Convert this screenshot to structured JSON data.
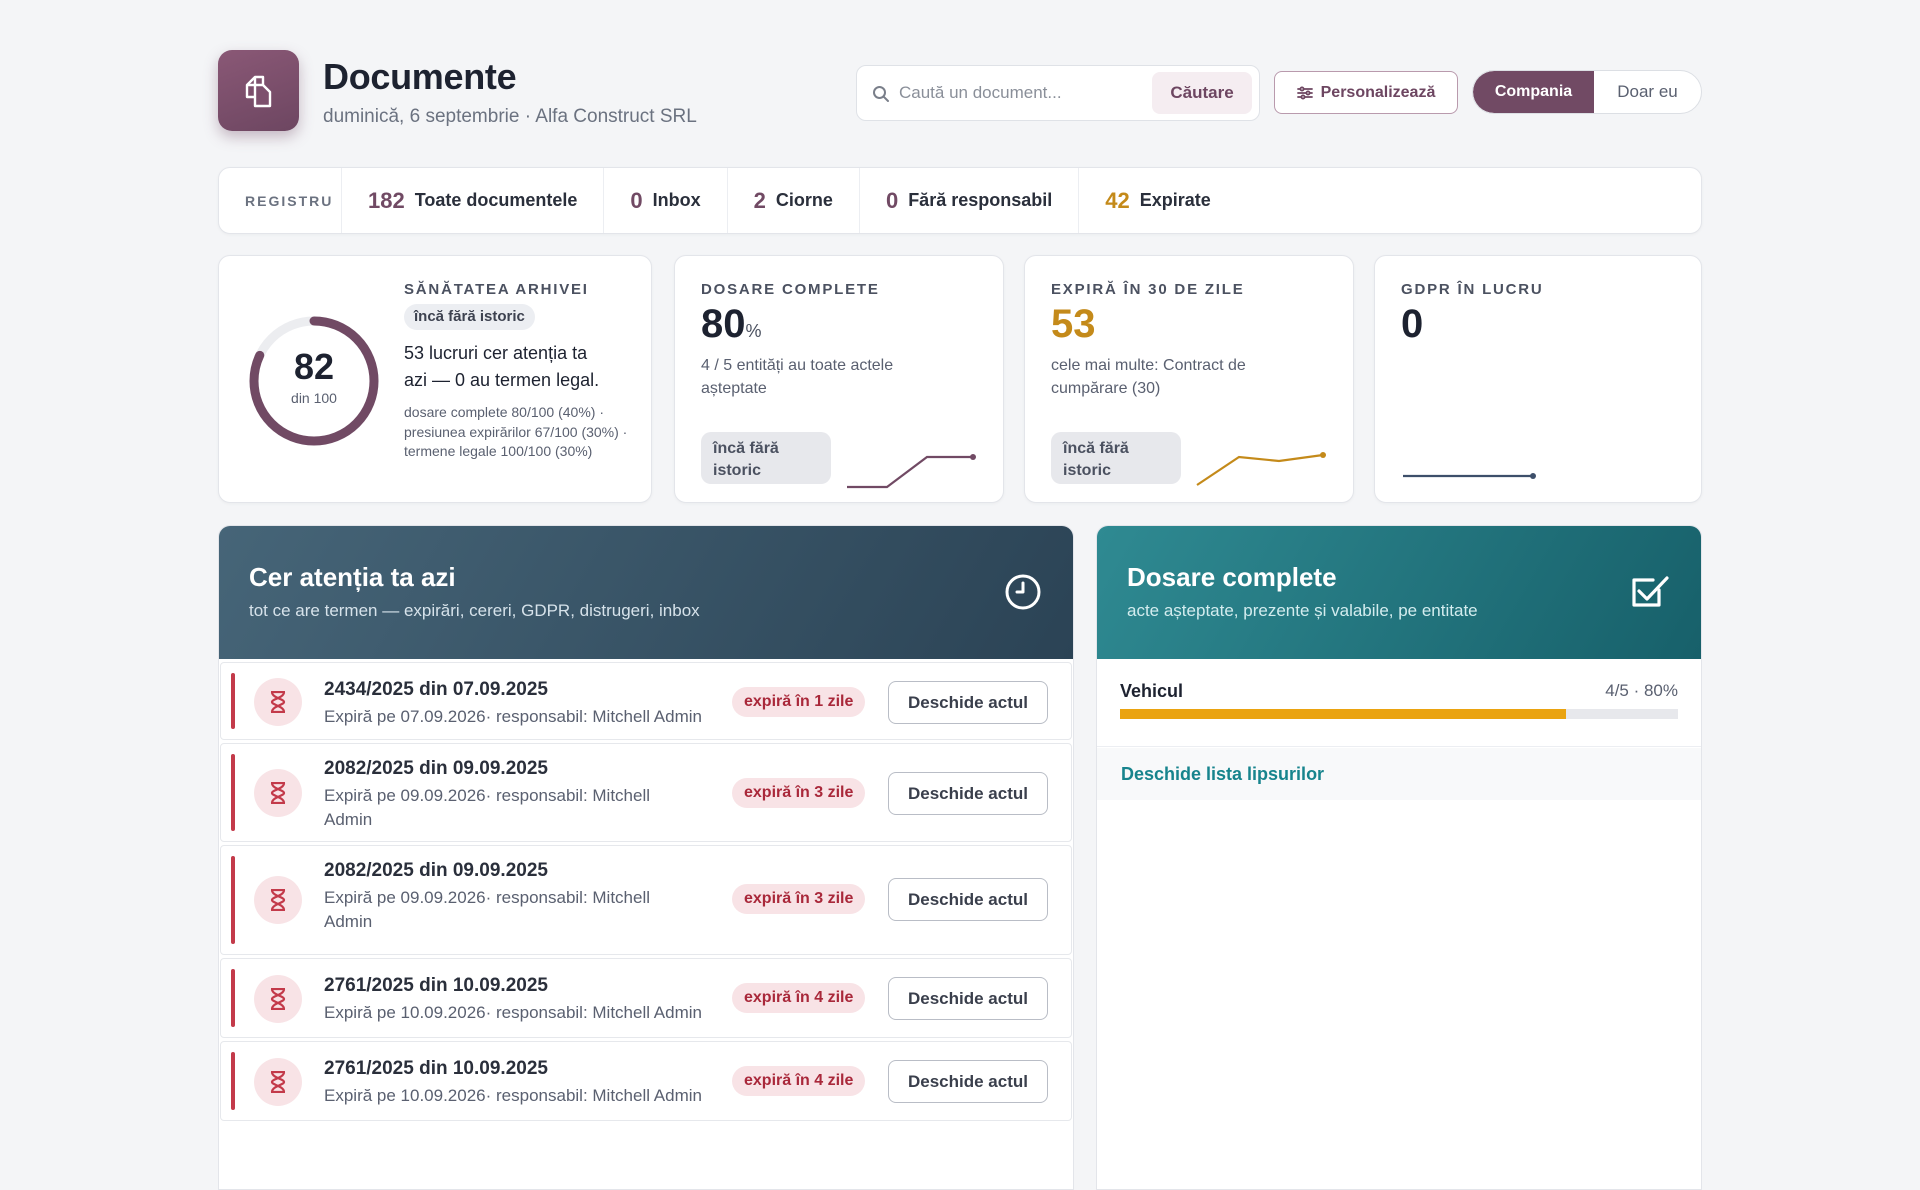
{
  "header": {
    "title": "Documente",
    "subtitle": "duminică, 6 septembrie · Alfa Construct SRL",
    "search_placeholder": "Caută un document...",
    "search_button": "Căutare",
    "customize_button": "Personalizează",
    "scope_company": "Compania",
    "scope_me": "Doar eu"
  },
  "registry": {
    "label": "REGISTRU",
    "items": [
      {
        "count": "182",
        "label": "Toate documentele"
      },
      {
        "count": "0",
        "label": "Inbox"
      },
      {
        "count": "2",
        "label": "Ciorne"
      },
      {
        "count": "0",
        "label": "Fără responsabil"
      },
      {
        "count": "42",
        "label": "Expirate"
      }
    ]
  },
  "health": {
    "score": "82",
    "score_of": "din 100",
    "score_fraction": 0.82,
    "title": "SĂNĂTATEA ARHIVEI",
    "badge": "încă fără istoric",
    "summary": "53 lucruri cer atenția ta azi — 0 au termen legal.",
    "detail": "dosare complete 80/100 (40%) · presiunea expirărilor 67/100 (30%) · termene legale 100/100 (30%)"
  },
  "kpis": {
    "complete": {
      "title": "DOSARE COMPLETE",
      "value": "80",
      "unit": "%",
      "desc": "4 / 5 entități au toate actele așteptate",
      "pill": "încă fără istoric"
    },
    "expiring": {
      "title": "EXPIRĂ ÎN 30 DE ZILE",
      "value": "53",
      "desc": "cele mai multe: Contract de cumpărare (30)",
      "pill": "încă fără istoric"
    },
    "gdpr": {
      "title": "GDPR ÎN LUCRU",
      "value": "0"
    }
  },
  "attention": {
    "title": "Cer atenția ta azi",
    "subtitle": "tot ce are termen — expirări, cereri, GDPR, distrugeri, inbox",
    "rows": [
      {
        "title": "2434/2025 din 07.09.2025",
        "sub": "Expiră pe 07.09.2026· responsabil: Mitchell Admin",
        "chip": "expiră în 1 zile",
        "action": "Deschide actul"
      },
      {
        "title": "2082/2025 din 09.09.2025",
        "sub": "Expiră pe 09.09.2026· responsabil: Mitchell Admin",
        "chip": "expiră în 3 zile",
        "action": "Deschide actul"
      },
      {
        "title": "2082/2025 din 09.09.2025",
        "sub": "Expiră pe 09.09.2026· responsabil: Mitchell Admin",
        "chip": "expiră în 3 zile",
        "action": "Deschide actul"
      },
      {
        "title": "2761/2025 din 10.09.2025",
        "sub": "Expiră pe 10.09.2026· responsabil: Mitchell Admin",
        "chip": "expiră în 4 zile",
        "action": "Deschide actul"
      },
      {
        "title": "2761/2025 din 10.09.2025",
        "sub": "Expiră pe 10.09.2026· responsabil: Mitchell Admin",
        "chip": "expiră în 4 zile",
        "action": "Deschide actul"
      }
    ]
  },
  "dossiers": {
    "title": "Dosare complete",
    "subtitle": "acte așteptate, prezente și valabile, pe entitate",
    "entities": [
      {
        "name": "Vehicul",
        "value": "4/5 · 80%",
        "fraction": 0.8
      }
    ],
    "missing_link": "Deschide lista lipsurilor"
  },
  "colors": {
    "brand": "#714a64",
    "amber": "#c48a1a",
    "alert": "#c33a4a",
    "teal": "#17848d"
  }
}
